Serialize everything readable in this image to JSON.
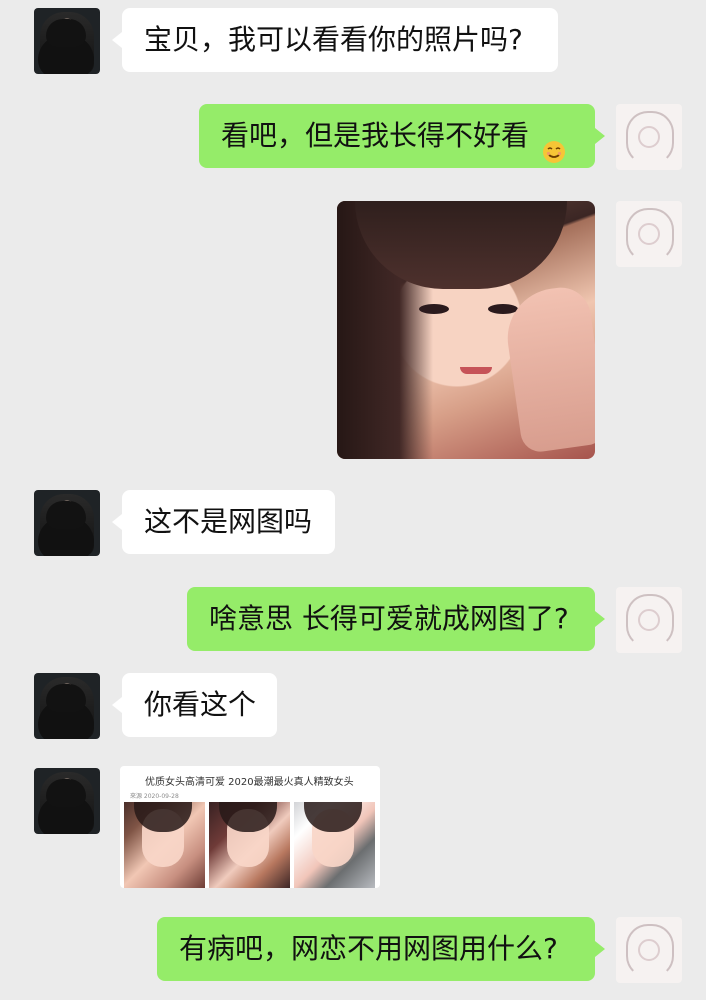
{
  "chat": {
    "messages": [
      {
        "side": "left",
        "type": "text",
        "text": "宝贝，我可以看看你的照片吗?"
      },
      {
        "side": "right",
        "type": "text",
        "text": "看吧，但是我长得不好看",
        "emoji": "smiling-face-emoji"
      },
      {
        "side": "right",
        "type": "image"
      },
      {
        "side": "left",
        "type": "text",
        "text": "这不是网图吗"
      },
      {
        "side": "right",
        "type": "text",
        "text": "啥意思 长得可爱就成网图了?"
      },
      {
        "side": "left",
        "type": "text",
        "text": "你看这个"
      },
      {
        "side": "left",
        "type": "image-card",
        "title": "优质女头高清可爱 2020最潮最火真人精致女头",
        "meta": "來源 2020-09-28"
      },
      {
        "side": "right",
        "type": "text",
        "text": "有病吧，网恋不用网图用什么?"
      }
    ]
  },
  "colors": {
    "background": "#ebebeb",
    "left_bubble": "#ffffff",
    "right_bubble": "#95ec69",
    "text": "#111111",
    "card_tag": "#4ea7ff"
  },
  "icons": {
    "left_avatar": "profile-photo-avatar-icon",
    "right_avatar": "drawn-girl-avatar-icon",
    "emoji": "blushing-face-icon"
  }
}
